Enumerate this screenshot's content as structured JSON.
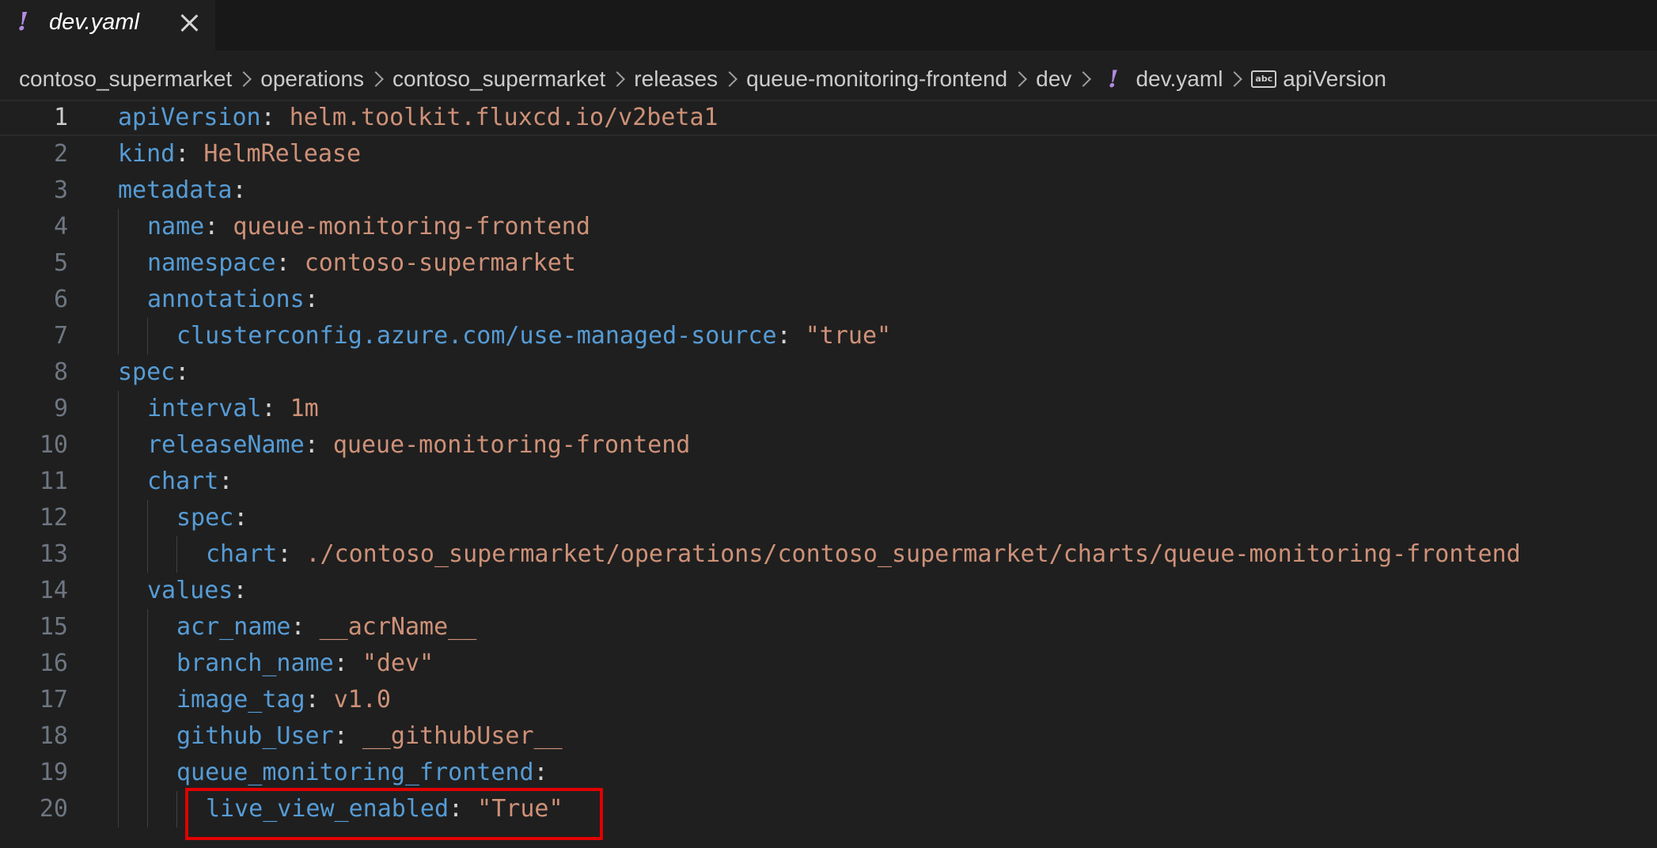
{
  "tab": {
    "icon": "yaml-exclamation-icon",
    "title": "dev.yaml",
    "close": "close-icon"
  },
  "breadcrumb": {
    "items": [
      "contoso_supermarket",
      "operations",
      "contoso_supermarket",
      "releases",
      "queue-monitoring-frontend",
      "dev"
    ],
    "file": "dev.yaml",
    "symbol": "apiVersion",
    "symbol_icon_text": "abc"
  },
  "editor": {
    "active_line": 1,
    "lines": [
      {
        "n": "1",
        "key": "apiVersion",
        "colon": ": ",
        "value": "helm.toolkit.fluxcd.io/v2beta1"
      },
      {
        "n": "2",
        "key": "kind",
        "colon": ": ",
        "value": "HelmRelease"
      },
      {
        "n": "3",
        "key": "metadata",
        "colon": ":",
        "value": ""
      },
      {
        "n": "4",
        "key": "name",
        "colon": ": ",
        "value": "queue-monitoring-frontend"
      },
      {
        "n": "5",
        "key": "namespace",
        "colon": ": ",
        "value": "contoso-supermarket"
      },
      {
        "n": "6",
        "key": "annotations",
        "colon": ":",
        "value": ""
      },
      {
        "n": "7",
        "key": "clusterconfig.azure.com/use-managed-source",
        "colon": ": ",
        "value": "\"true\""
      },
      {
        "n": "8",
        "key": "spec",
        "colon": ":",
        "value": ""
      },
      {
        "n": "9",
        "key": "interval",
        "colon": ": ",
        "value": "1m"
      },
      {
        "n": "10",
        "key": "releaseName",
        "colon": ": ",
        "value": "queue-monitoring-frontend"
      },
      {
        "n": "11",
        "key": "chart",
        "colon": ":",
        "value": ""
      },
      {
        "n": "12",
        "key": "spec",
        "colon": ":",
        "value": ""
      },
      {
        "n": "13",
        "key": "chart",
        "colon": ": ",
        "value": "./contoso_supermarket/operations/contoso_supermarket/charts/queue-monitoring-frontend"
      },
      {
        "n": "14",
        "key": "values",
        "colon": ":",
        "value": ""
      },
      {
        "n": "15",
        "key": "acr_name",
        "colon": ": ",
        "value": "__acrName__"
      },
      {
        "n": "16",
        "key": "branch_name",
        "colon": ": ",
        "value": "\"dev\""
      },
      {
        "n": "17",
        "key": "image_tag",
        "colon": ": ",
        "value": "v1.0"
      },
      {
        "n": "18",
        "key": "github_User",
        "colon": ": ",
        "value": "__githubUser__"
      },
      {
        "n": "19",
        "key": "queue_monitoring_frontend",
        "colon": ":",
        "value": ""
      },
      {
        "n": "20",
        "key": "live_view_enabled",
        "colon": ": ",
        "value": "\"True\""
      }
    ]
  },
  "colors": {
    "key": "#569cd6",
    "string": "#ce9178",
    "highlight_box": "#e00000",
    "yaml_icon": "#b18be0"
  }
}
